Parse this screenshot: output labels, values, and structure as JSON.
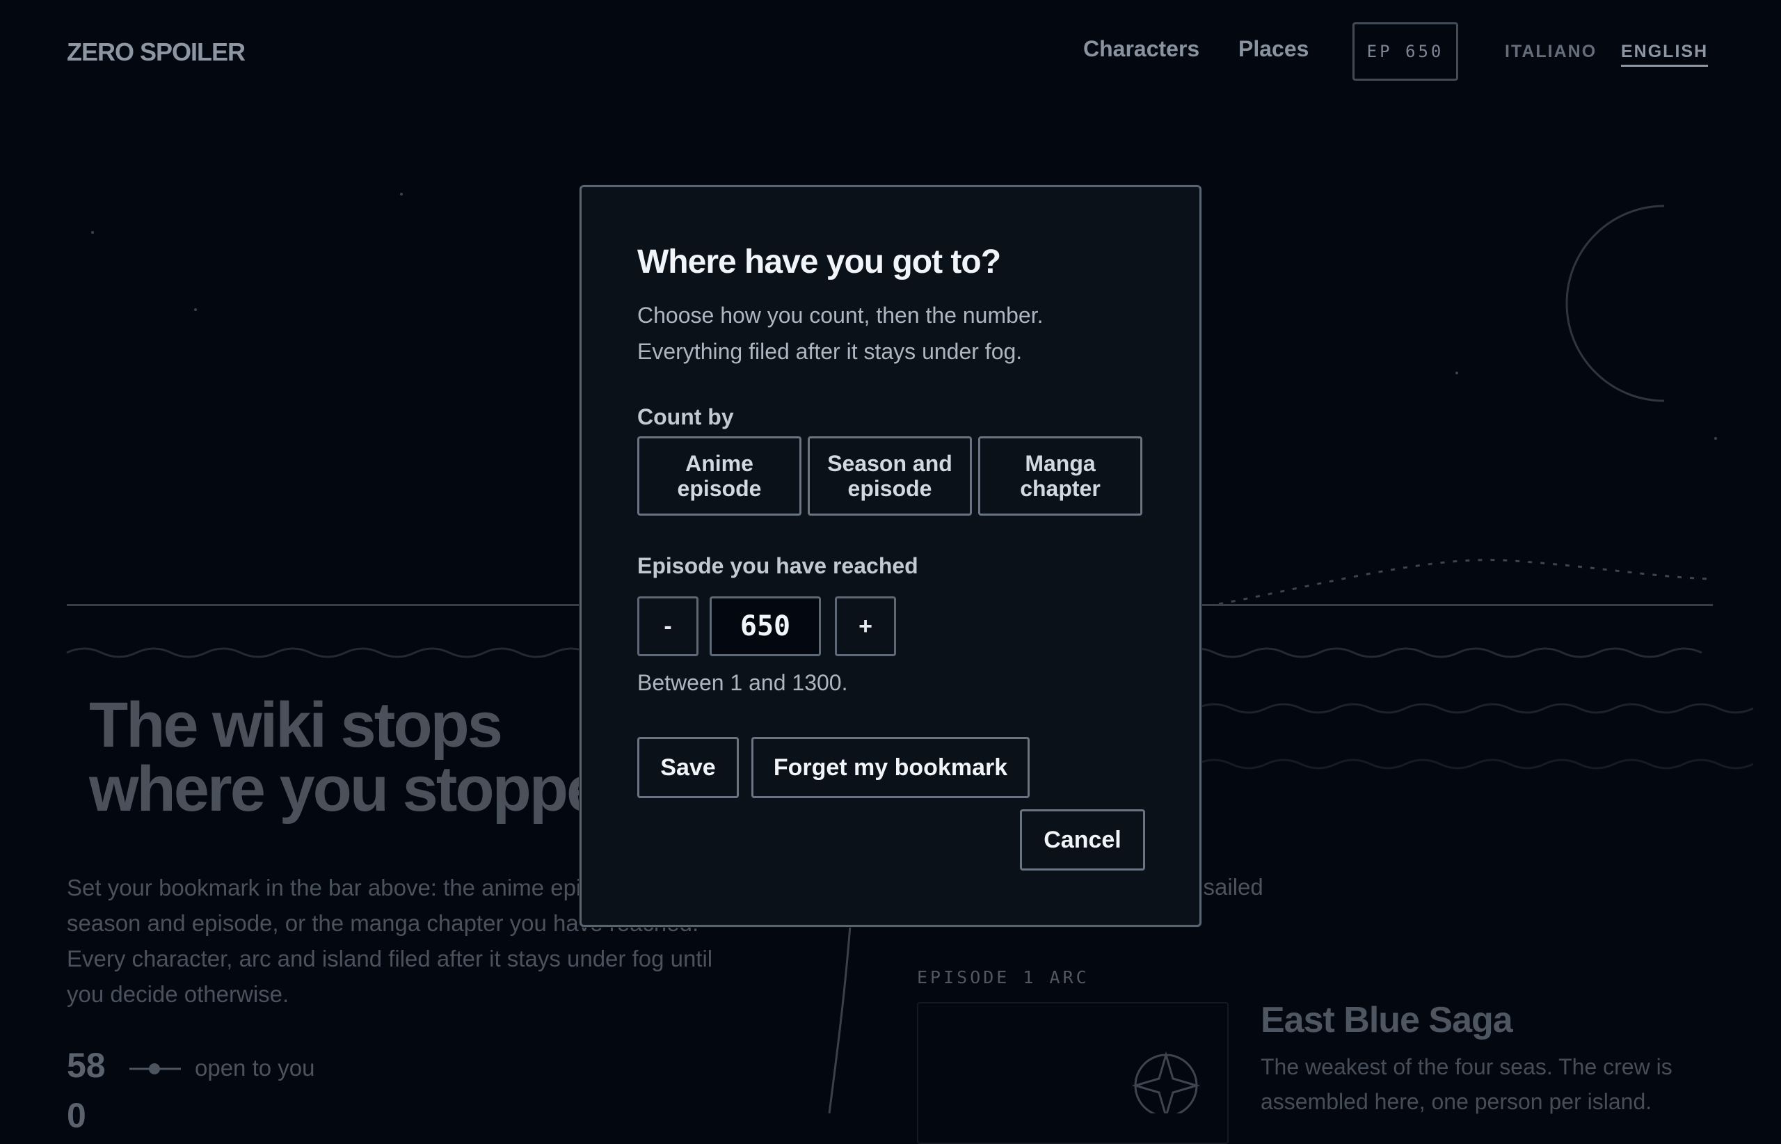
{
  "header": {
    "logo": "ZERO SPOILER",
    "nav": [
      "Characters",
      "Places"
    ],
    "bookmark_badge": "EP 650",
    "languages": [
      "ITALIANO",
      "ENGLISH"
    ],
    "active_language": "ENGLISH"
  },
  "hero": {
    "title_lines": [
      "The wiki stops",
      "where you stoppe"
    ],
    "text_lines": [
      "Set your bookmark in the bar above: the anime epis",
      "season and episode, or the manga chapter you have reached.",
      "Every character, arc and island filed after it stays under fog until",
      "you decide otherwise."
    ],
    "stat_number": "58",
    "stat_label": "open to you",
    "stat_number_2": "0"
  },
  "journey": {
    "sailed_text": "e sailed",
    "arc_label": "EPISODE 1  ARC",
    "arc_title": "East Blue Saga",
    "arc_text_lines": [
      "The weakest of the four seas. The crew is",
      "assembled here, one person per island."
    ]
  },
  "modal": {
    "title": "Where have you got to?",
    "description_lines": [
      "Choose how you count, then the number.",
      "Everything filed after it stays under fog."
    ],
    "count_by_label": "Count by",
    "count_options": [
      {
        "line1": "Anime",
        "line2": "episode"
      },
      {
        "line1": "Season and",
        "line2": "episode"
      },
      {
        "line1": "Manga",
        "line2": "chapter"
      }
    ],
    "reached_label": "Episode you have reached",
    "decrement": "-",
    "increment": "+",
    "episode_value": "650",
    "range_hint": "Between 1 and 1300.",
    "save": "Save",
    "forget": "Forget my bookmark",
    "cancel": "Cancel"
  },
  "colors": {
    "background": "#03070f",
    "modal_bg": "#0a1119",
    "modal_border": "#5a6370"
  }
}
